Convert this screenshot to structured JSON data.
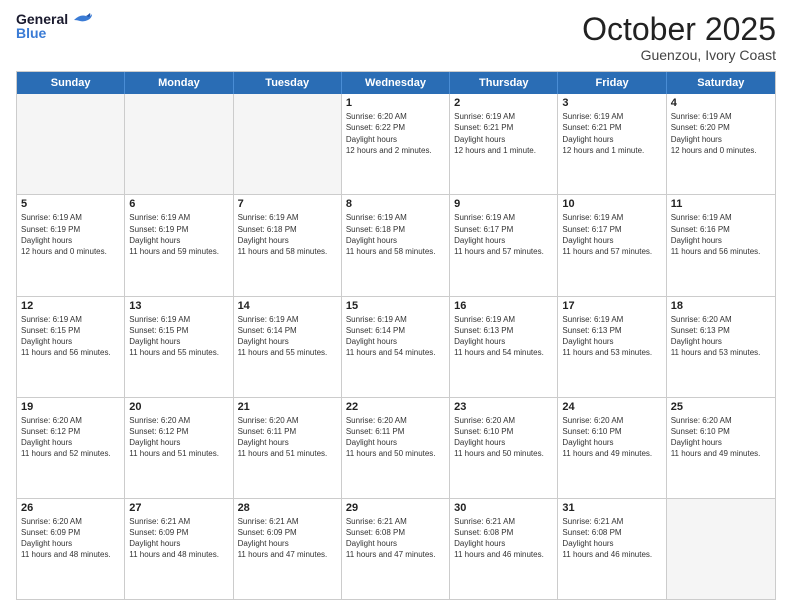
{
  "header": {
    "logo_general": "General",
    "logo_blue": "Blue",
    "month_title": "October 2025",
    "location": "Guenzou, Ivory Coast"
  },
  "days_of_week": [
    "Sunday",
    "Monday",
    "Tuesday",
    "Wednesday",
    "Thursday",
    "Friday",
    "Saturday"
  ],
  "weeks": [
    [
      {
        "day": "",
        "empty": true
      },
      {
        "day": "",
        "empty": true
      },
      {
        "day": "",
        "empty": true
      },
      {
        "day": "1",
        "sunrise": "6:20 AM",
        "sunset": "6:22 PM",
        "daylight": "12 hours and 2 minutes."
      },
      {
        "day": "2",
        "sunrise": "6:19 AM",
        "sunset": "6:21 PM",
        "daylight": "12 hours and 1 minute."
      },
      {
        "day": "3",
        "sunrise": "6:19 AM",
        "sunset": "6:21 PM",
        "daylight": "12 hours and 1 minute."
      },
      {
        "day": "4",
        "sunrise": "6:19 AM",
        "sunset": "6:20 PM",
        "daylight": "12 hours and 0 minutes."
      }
    ],
    [
      {
        "day": "5",
        "sunrise": "6:19 AM",
        "sunset": "6:19 PM",
        "daylight": "12 hours and 0 minutes."
      },
      {
        "day": "6",
        "sunrise": "6:19 AM",
        "sunset": "6:19 PM",
        "daylight": "11 hours and 59 minutes."
      },
      {
        "day": "7",
        "sunrise": "6:19 AM",
        "sunset": "6:18 PM",
        "daylight": "11 hours and 58 minutes."
      },
      {
        "day": "8",
        "sunrise": "6:19 AM",
        "sunset": "6:18 PM",
        "daylight": "11 hours and 58 minutes."
      },
      {
        "day": "9",
        "sunrise": "6:19 AM",
        "sunset": "6:17 PM",
        "daylight": "11 hours and 57 minutes."
      },
      {
        "day": "10",
        "sunrise": "6:19 AM",
        "sunset": "6:17 PM",
        "daylight": "11 hours and 57 minutes."
      },
      {
        "day": "11",
        "sunrise": "6:19 AM",
        "sunset": "6:16 PM",
        "daylight": "11 hours and 56 minutes."
      }
    ],
    [
      {
        "day": "12",
        "sunrise": "6:19 AM",
        "sunset": "6:15 PM",
        "daylight": "11 hours and 56 minutes."
      },
      {
        "day": "13",
        "sunrise": "6:19 AM",
        "sunset": "6:15 PM",
        "daylight": "11 hours and 55 minutes."
      },
      {
        "day": "14",
        "sunrise": "6:19 AM",
        "sunset": "6:14 PM",
        "daylight": "11 hours and 55 minutes."
      },
      {
        "day": "15",
        "sunrise": "6:19 AM",
        "sunset": "6:14 PM",
        "daylight": "11 hours and 54 minutes."
      },
      {
        "day": "16",
        "sunrise": "6:19 AM",
        "sunset": "6:13 PM",
        "daylight": "11 hours and 54 minutes."
      },
      {
        "day": "17",
        "sunrise": "6:19 AM",
        "sunset": "6:13 PM",
        "daylight": "11 hours and 53 minutes."
      },
      {
        "day": "18",
        "sunrise": "6:20 AM",
        "sunset": "6:13 PM",
        "daylight": "11 hours and 53 minutes."
      }
    ],
    [
      {
        "day": "19",
        "sunrise": "6:20 AM",
        "sunset": "6:12 PM",
        "daylight": "11 hours and 52 minutes."
      },
      {
        "day": "20",
        "sunrise": "6:20 AM",
        "sunset": "6:12 PM",
        "daylight": "11 hours and 51 minutes."
      },
      {
        "day": "21",
        "sunrise": "6:20 AM",
        "sunset": "6:11 PM",
        "daylight": "11 hours and 51 minutes."
      },
      {
        "day": "22",
        "sunrise": "6:20 AM",
        "sunset": "6:11 PM",
        "daylight": "11 hours and 50 minutes."
      },
      {
        "day": "23",
        "sunrise": "6:20 AM",
        "sunset": "6:10 PM",
        "daylight": "11 hours and 50 minutes."
      },
      {
        "day": "24",
        "sunrise": "6:20 AM",
        "sunset": "6:10 PM",
        "daylight": "11 hours and 49 minutes."
      },
      {
        "day": "25",
        "sunrise": "6:20 AM",
        "sunset": "6:10 PM",
        "daylight": "11 hours and 49 minutes."
      }
    ],
    [
      {
        "day": "26",
        "sunrise": "6:20 AM",
        "sunset": "6:09 PM",
        "daylight": "11 hours and 48 minutes."
      },
      {
        "day": "27",
        "sunrise": "6:21 AM",
        "sunset": "6:09 PM",
        "daylight": "11 hours and 48 minutes."
      },
      {
        "day": "28",
        "sunrise": "6:21 AM",
        "sunset": "6:09 PM",
        "daylight": "11 hours and 47 minutes."
      },
      {
        "day": "29",
        "sunrise": "6:21 AM",
        "sunset": "6:08 PM",
        "daylight": "11 hours and 47 minutes."
      },
      {
        "day": "30",
        "sunrise": "6:21 AM",
        "sunset": "6:08 PM",
        "daylight": "11 hours and 46 minutes."
      },
      {
        "day": "31",
        "sunrise": "6:21 AM",
        "sunset": "6:08 PM",
        "daylight": "11 hours and 46 minutes."
      },
      {
        "day": "",
        "empty": true
      }
    ]
  ],
  "labels": {
    "sunrise": "Sunrise:",
    "sunset": "Sunset:",
    "daylight": "Daylight hours"
  }
}
